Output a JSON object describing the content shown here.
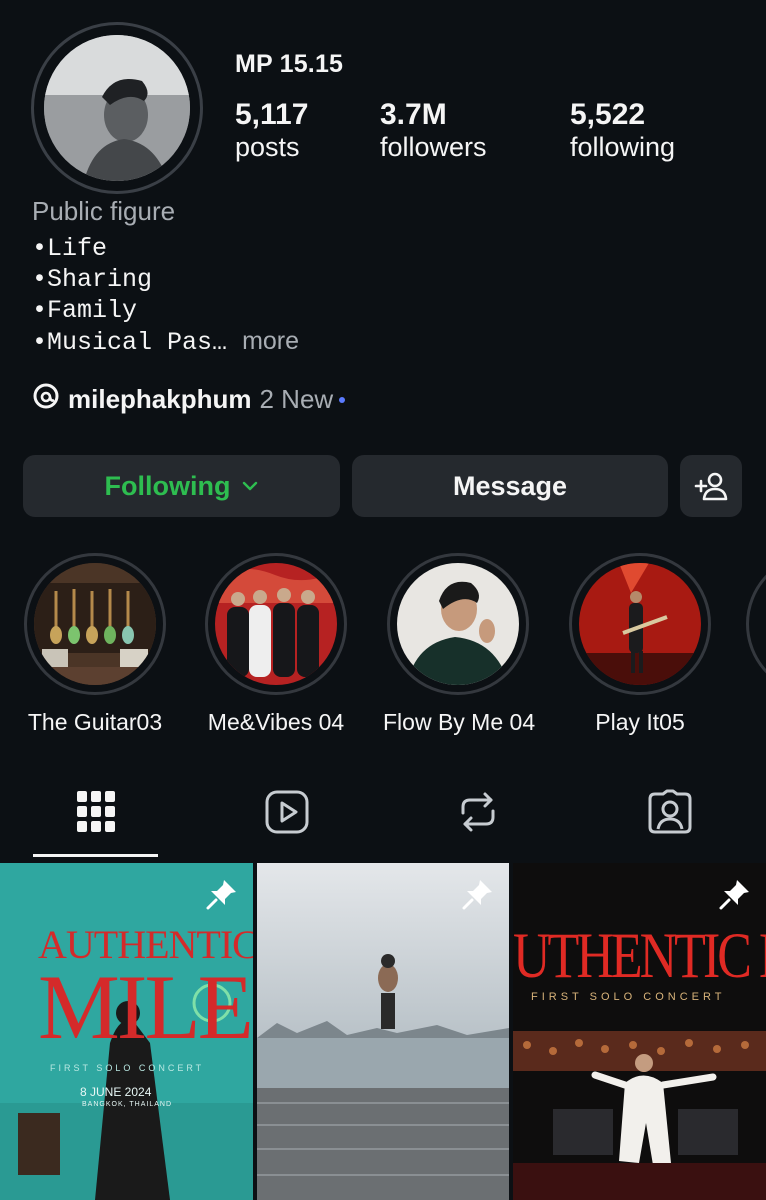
{
  "profile": {
    "name": "MP 15.15",
    "stats": {
      "posts": {
        "value": "5,117",
        "label": "posts"
      },
      "followers": {
        "value": "3.7M",
        "label": "followers"
      },
      "following": {
        "value": "5,522",
        "label": "following"
      }
    },
    "category": "Public figure",
    "bio_lines": [
      "•Life",
      "•Sharing",
      "•Family",
      "•Musical Pas…"
    ],
    "bio_more": "more",
    "threads": {
      "username": "milephakphum",
      "badge": "2 New"
    }
  },
  "actions": {
    "following_label": "Following",
    "message_label": "Message",
    "add_user_icon": "add-person-icon"
  },
  "highlights": [
    {
      "label": "The Guitar03"
    },
    {
      "label": "Me&Vibes 04"
    },
    {
      "label": "Flow By Me 04"
    },
    {
      "label": "Play It05"
    }
  ],
  "tabs": [
    {
      "name": "posts",
      "icon": "grid-icon",
      "active": true
    },
    {
      "name": "reels",
      "icon": "reels-icon",
      "active": false
    },
    {
      "name": "reposts",
      "icon": "repost-icon",
      "active": false
    },
    {
      "name": "tagged",
      "icon": "tagged-icon",
      "active": false
    }
  ],
  "posts": [
    {
      "pinned": true,
      "title": "AUTHENTIC",
      "subtitle": "MILE",
      "caption": "FIRST SOLO CONCERT",
      "date": "8 JUNE 2024",
      "note": "BANGKOK, THAILAND"
    },
    {
      "pinned": true
    },
    {
      "pinned": true,
      "title": "UTHENTIC MIL",
      "caption": "FIRST SOLO CONCERT"
    }
  ],
  "colors": {
    "background": "#0c1014",
    "button": "#25292e",
    "following_green": "#2ebd50",
    "muted_text": "#a8adb3",
    "new_dot": "#5b7bff"
  }
}
